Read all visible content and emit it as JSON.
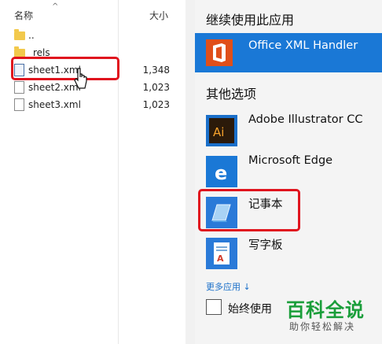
{
  "explorer": {
    "col_name": "名称",
    "col_size": "大小",
    "rows": [
      {
        "name": "..",
        "size": "",
        "type": "folder"
      },
      {
        "name": "_rels",
        "size": "",
        "type": "folder"
      },
      {
        "name": "sheet1.xml",
        "size": "1,348",
        "type": "file"
      },
      {
        "name": "sheet2.xml",
        "size": "1,023",
        "type": "file"
      },
      {
        "name": "sheet3.xml",
        "size": "1,023",
        "type": "file"
      }
    ]
  },
  "chooser": {
    "continue_heading": "继续使用此应用",
    "current_app": "Office XML Handler",
    "other_heading": "其他选项",
    "apps": [
      {
        "name": "Adobe Illustrator CC",
        "icon": "illustrator-icon",
        "color": "#2a1a0a"
      },
      {
        "name": "Microsoft Edge",
        "icon": "edge-icon",
        "color": "#1a78d6"
      },
      {
        "name": "记事本",
        "icon": "notepad-icon",
        "color": "#2a7ad8"
      },
      {
        "name": "写字板",
        "icon": "wordpad-icon",
        "color": "#2a7ad8"
      }
    ],
    "more_apps": "更多应用 ↓",
    "always_use": "始终使用"
  },
  "watermark": {
    "main": "百科全说",
    "sub": "助你轻松解决"
  },
  "colors": {
    "accent": "#1a78d6",
    "highlight_box": "#e0141e"
  }
}
